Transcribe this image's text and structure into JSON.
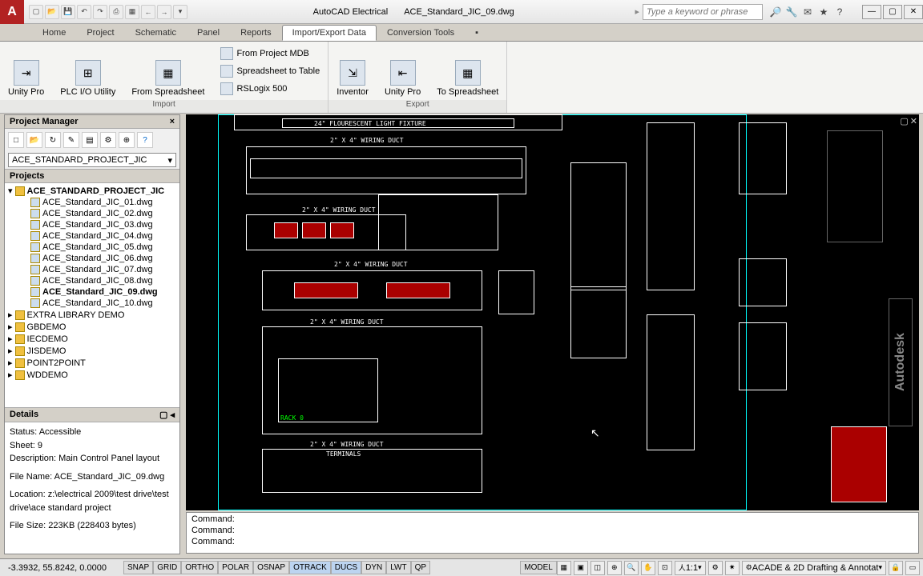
{
  "app_title": "AutoCAD Electrical",
  "doc_title": "ACE_Standard_JIC_09.dwg",
  "search_placeholder": "Type a keyword or phrase",
  "tabs": [
    "Home",
    "Project",
    "Schematic",
    "Panel",
    "Reports",
    "Import/Export Data",
    "Conversion Tools"
  ],
  "active_tab": 5,
  "ribbon": {
    "import_label": "Import",
    "export_label": "Export",
    "unity_pro": "Unity Pro",
    "plc_io": "PLC I/O Utility",
    "from_ss": "From Spreadsheet",
    "from_mdb": "From Project MDB",
    "ss_to_table": "Spreadsheet to Table",
    "rslogix": "RSLogix 500",
    "inventor": "Inventor",
    "to_ss": "To Spreadsheet"
  },
  "pm": {
    "title": "Project Manager",
    "project_dd": "ACE_STANDARD_PROJECT_JIC",
    "projects_hdr": "Projects",
    "root": "ACE_STANDARD_PROJECT_JIC",
    "files": [
      "ACE_Standard_JIC_01.dwg",
      "ACE_Standard_JIC_02.dwg",
      "ACE_Standard_JIC_03.dwg",
      "ACE_Standard_JIC_04.dwg",
      "ACE_Standard_JIC_05.dwg",
      "ACE_Standard_JIC_06.dwg",
      "ACE_Standard_JIC_07.dwg",
      "ACE_Standard_JIC_08.dwg",
      "ACE_Standard_JIC_09.dwg",
      "ACE_Standard_JIC_10.dwg"
    ],
    "active_file": 8,
    "extra_projects": [
      "EXTRA LIBRARY DEMO",
      "GBDEMO",
      "IECDEMO",
      "JISDEMO",
      "POINT2POINT",
      "WDDEMO"
    ],
    "details_hdr": "Details",
    "details": {
      "status": "Status: Accessible",
      "sheet": "Sheet: 9",
      "desc": "Description: Main Control Panel layout",
      "fname": "File Name: ACE_Standard_JIC_09.dwg",
      "loc": "Location: z:\\electrical 2009\\test drive\\test drive\\ace standard project",
      "size": "File Size: 223KB (228403 bytes)"
    }
  },
  "canvas": {
    "title_label": "24\" FLOURESCENT LIGHT FIXTURE",
    "duct1": "2\" X 4\" WIRING DUCT",
    "duct2": "2\" X 4\" WIRING DUCT",
    "duct3": "2\" X 4\" WIRING DUCT",
    "duct4": "2\" X 4\" WIRING DUCT",
    "duct5": "2\" X 4\" WIRING DUCT",
    "terminals": "TERMINALS",
    "rack": "RACK 0",
    "autodesk": "Autodesk"
  },
  "cmd": {
    "l1": "Command:",
    "l2": "Command:",
    "l3": "Command:"
  },
  "status": {
    "coords": "-3.3932, 55.8242, 0.0000",
    "toggles": [
      "SNAP",
      "GRID",
      "ORTHO",
      "POLAR",
      "OSNAP",
      "OTRACK",
      "DUCS",
      "DYN",
      "LWT",
      "QP"
    ],
    "toggles_on": [
      5,
      6
    ],
    "model": "MODEL",
    "scale": "1:1",
    "workspace": "ACADE & 2D Drafting & Annotat"
  }
}
